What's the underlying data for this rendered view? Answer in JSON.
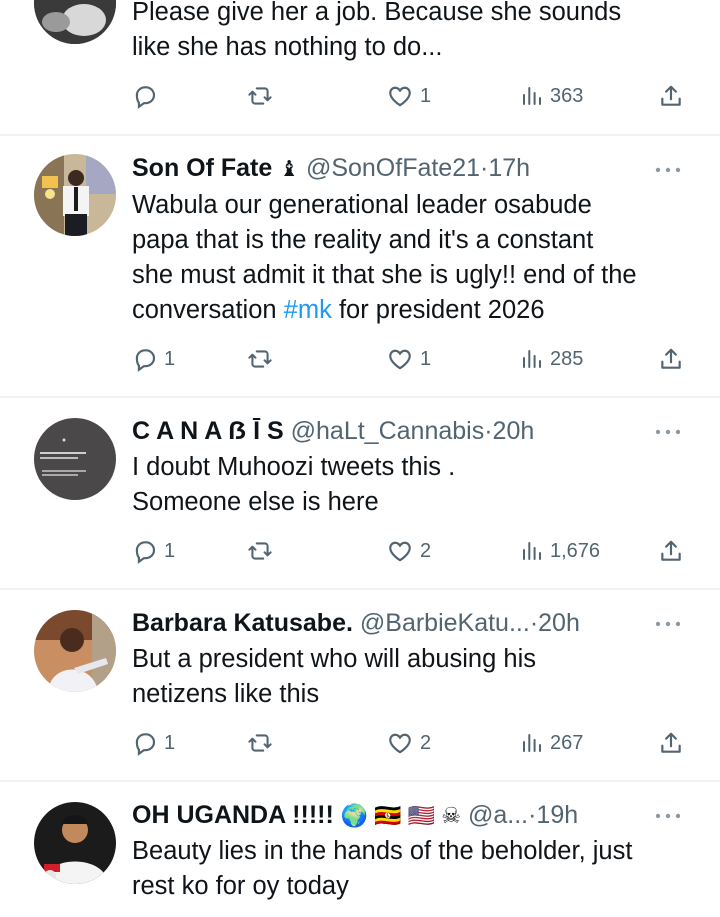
{
  "tweets": [
    {
      "name": "",
      "handle": "",
      "time": "",
      "text": "Please give her a job. Because she sounds\nlike she has nothing to do...",
      "replies": "",
      "likes": "1",
      "views": "363"
    },
    {
      "name": "Son Of Fate",
      "name_emoji": "♝",
      "handle": "@SonOfFate21",
      "sep": "·",
      "time": "17h",
      "text_before": "Wabula our generational leader osabude\npapa that is the reality and it's a constant\nshe must admit it that she is ugly!! end of the\nconversation ",
      "hashtag": "#mk",
      "text_after": " for president 2026",
      "replies": "1",
      "likes": "1",
      "views": "285"
    },
    {
      "name": "C A N A ẞ Ī S",
      "handle": "@haLt_Cannabis",
      "sep": "·",
      "time": "20h",
      "text": "I doubt Muhoozi tweets this .\nSomeone else is here",
      "replies": "1",
      "likes": "2",
      "views": "1,676"
    },
    {
      "name": "Barbara Katusabe.",
      "handle": "@BarbieKatu...",
      "sep": "·",
      "time": "20h",
      "text": "But a president who will abusing his\nnetizens  like this",
      "replies": "1",
      "likes": "2",
      "views": "267"
    },
    {
      "name": "OH UGANDA !!!!!",
      "name_emoji": "🌍 🇺🇬 🇺🇸 ☠",
      "handle": "@a...",
      "sep": "·",
      "time": "19h",
      "text": "Beauty lies in the hands of the beholder, just\nrest ko for oy today"
    }
  ],
  "colors": {
    "text": "#0f1419",
    "secondary": "#536471",
    "link": "#1d9bf0",
    "divider": "#eff3f4"
  },
  "icons": [
    "reply-icon",
    "retweet-icon",
    "like-icon",
    "views-icon",
    "share-icon",
    "more-icon"
  ]
}
